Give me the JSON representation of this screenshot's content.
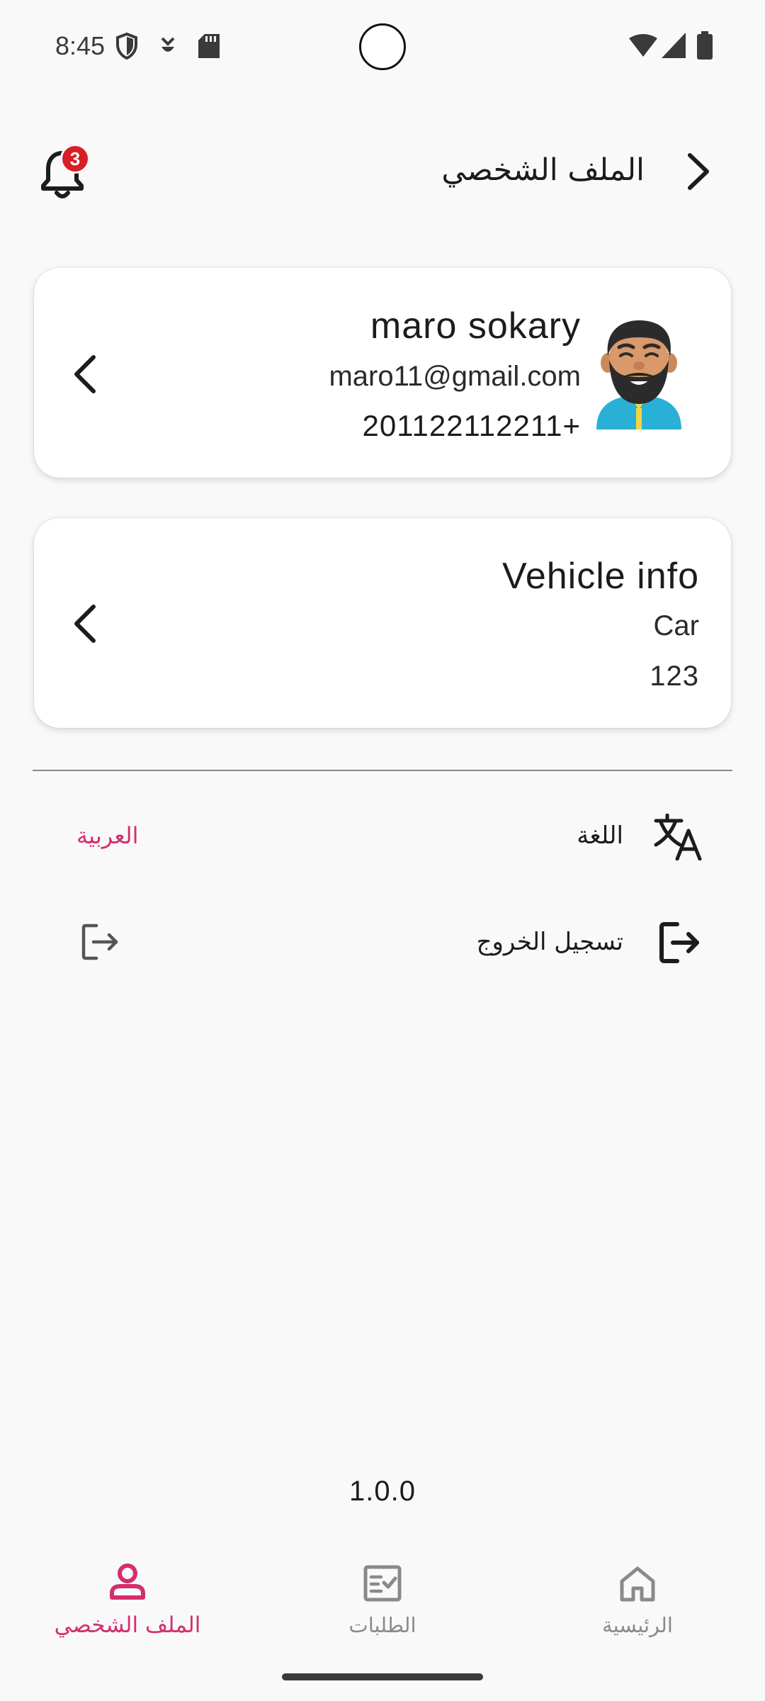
{
  "status_bar": {
    "time": "8:45"
  },
  "header": {
    "title": "الملف الشخصي",
    "notification_count": "3"
  },
  "profile": {
    "name": "maro sokary",
    "email": "maro11@gmail.com",
    "phone": "201122112211+"
  },
  "vehicle": {
    "title": "Vehicle info",
    "type": "Car",
    "number": "123"
  },
  "settings": {
    "language_label": "اللغة",
    "language_value": "العربية",
    "logout_label": "تسجيل الخروج"
  },
  "version": "1.0.0",
  "bottom_nav": {
    "profile": "الملف الشخصي",
    "orders": "الطلبات",
    "home": "الرئيسية",
    "active": "profile"
  },
  "colors": {
    "accent": "#d42e6e",
    "badge": "#d81f26",
    "inactive": "#8a8a8a",
    "background": "#f9f9f9"
  },
  "icons": {
    "status_left": [
      "shield-icon",
      "usb-debug-icon",
      "sd-card-icon"
    ],
    "status_right": [
      "wifi-icon",
      "signal-icon",
      "battery-icon"
    ],
    "header": [
      "notification-bell-icon",
      "back-arrow-icon"
    ],
    "settings": [
      "translate-icon",
      "logout-icon"
    ],
    "nav": [
      "person-icon",
      "orders-checklist-icon",
      "home-icon"
    ]
  }
}
